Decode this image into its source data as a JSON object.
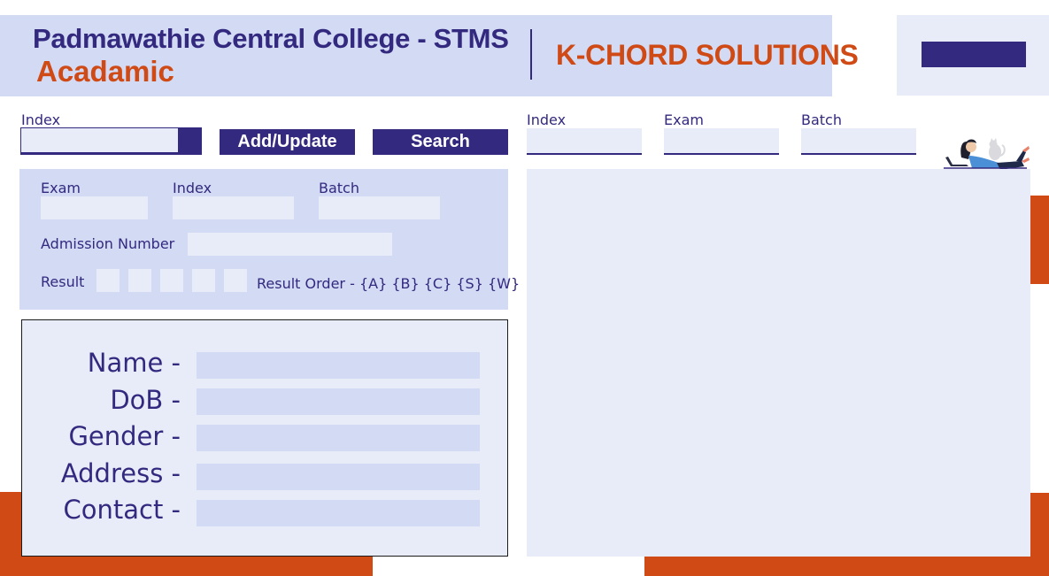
{
  "header": {
    "title": "Padmawathie Central College - STMS",
    "subtitle": "Acadamic",
    "company": "K-CHORD SOLUTIONS"
  },
  "search_bar": {
    "index_label": "Index",
    "index_value": "",
    "add_update_label": "Add/Update",
    "search_label": "Search"
  },
  "entry_panel": {
    "exam_label": "Exam",
    "index_label": "Index",
    "batch_label": "Batch",
    "admission_label": "Admission Number",
    "result_label": "Result",
    "result_order_label": "Result Order - {A} {B} {C} {S} {W}"
  },
  "details": {
    "name_label": "Name -",
    "dob_label": "DoB -",
    "gender_label": "Gender -",
    "address_label": "Address -",
    "contact_label": "Contact -"
  },
  "filter": {
    "index_label": "Index",
    "exam_label": "Exam",
    "batch_label": "Batch"
  },
  "colors": {
    "primary": "#33297f",
    "accent": "#cf4a15",
    "panel": "#d2daf4",
    "field": "#e8ecf8"
  },
  "icons": {
    "illustration": "person-with-laptop-and-cat-illustration"
  }
}
